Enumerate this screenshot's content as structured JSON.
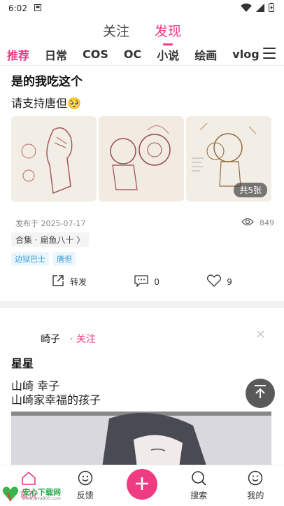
{
  "status": {
    "time": "6:02"
  },
  "top_tabs": [
    {
      "label": "关注",
      "active": false
    },
    {
      "label": "发现",
      "active": true
    }
  ],
  "categories": [
    "推荐",
    "日常",
    "COS",
    "OC",
    "小说",
    "绘画",
    "vlog"
  ],
  "post1": {
    "title": "是的我吃这个",
    "text": "请支持唐但🥺",
    "image_count": "共5张",
    "date": "发布于 2025-07-17",
    "views": "849",
    "collection": "合集 · 扁鱼八十 〉",
    "tags": [
      "边狱巴士",
      "唐但"
    ],
    "actions": {
      "share": "转发",
      "comments": "0",
      "likes": "9"
    }
  },
  "post2": {
    "author": "崎子",
    "follow": "· 关注",
    "title": "星星",
    "lines": [
      "山崎 幸子",
      "山崎家幸福的孩子"
    ]
  },
  "nav": {
    "home": "首页",
    "feedback": "反馈",
    "search": "搜索",
    "mine": "我的"
  },
  "watermark": {
    "name": "安心下载网",
    "url": "www.java800.com"
  },
  "colors": {
    "accent": "#ee3b82",
    "tag": "#3a9bd5"
  }
}
